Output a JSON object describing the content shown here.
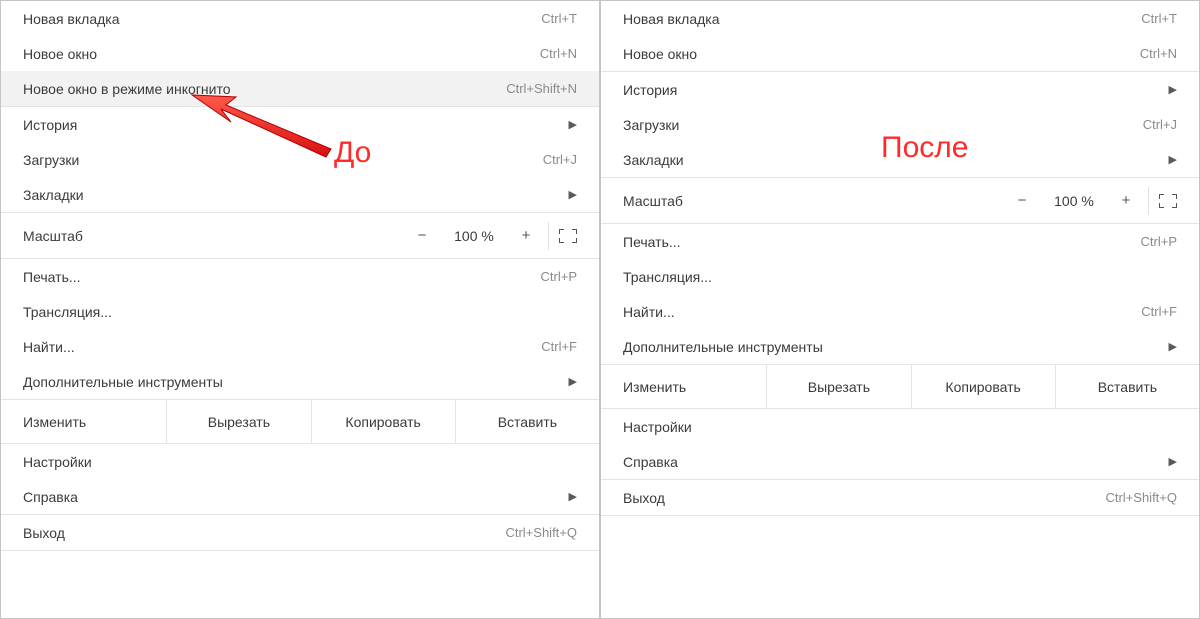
{
  "before": {
    "label": "До",
    "items": {
      "new_tab": "Новая вкладка",
      "new_tab_sc": "Ctrl+T",
      "new_window": "Новое окно",
      "new_window_sc": "Ctrl+N",
      "incognito": "Новое окно в режиме инкогнито",
      "incognito_sc": "Ctrl+Shift+N",
      "history": "История",
      "downloads": "Загрузки",
      "downloads_sc": "Ctrl+J",
      "bookmarks": "Закладки",
      "zoom": "Масштаб",
      "zoom_pct": "100 %",
      "print": "Печать...",
      "print_sc": "Ctrl+P",
      "cast": "Трансляция...",
      "find": "Найти...",
      "find_sc": "Ctrl+F",
      "more_tools": "Дополнительные инструменты",
      "edit": "Изменить",
      "cut": "Вырезать",
      "copy": "Копировать",
      "paste": "Вставить",
      "settings": "Настройки",
      "help": "Справка",
      "exit": "Выход",
      "exit_sc": "Ctrl+Shift+Q"
    }
  },
  "after": {
    "label": "После",
    "items": {
      "new_tab": "Новая вкладка",
      "new_tab_sc": "Ctrl+T",
      "new_window": "Новое окно",
      "new_window_sc": "Ctrl+N",
      "history": "История",
      "downloads": "Загрузки",
      "downloads_sc": "Ctrl+J",
      "bookmarks": "Закладки",
      "zoom": "Масштаб",
      "zoom_pct": "100 %",
      "print": "Печать...",
      "print_sc": "Ctrl+P",
      "cast": "Трансляция...",
      "find": "Найти...",
      "find_sc": "Ctrl+F",
      "more_tools": "Дополнительные инструменты",
      "edit": "Изменить",
      "cut": "Вырезать",
      "copy": "Копировать",
      "paste": "Вставить",
      "settings": "Настройки",
      "help": "Справка",
      "exit": "Выход",
      "exit_sc": "Ctrl+Shift+Q"
    }
  }
}
